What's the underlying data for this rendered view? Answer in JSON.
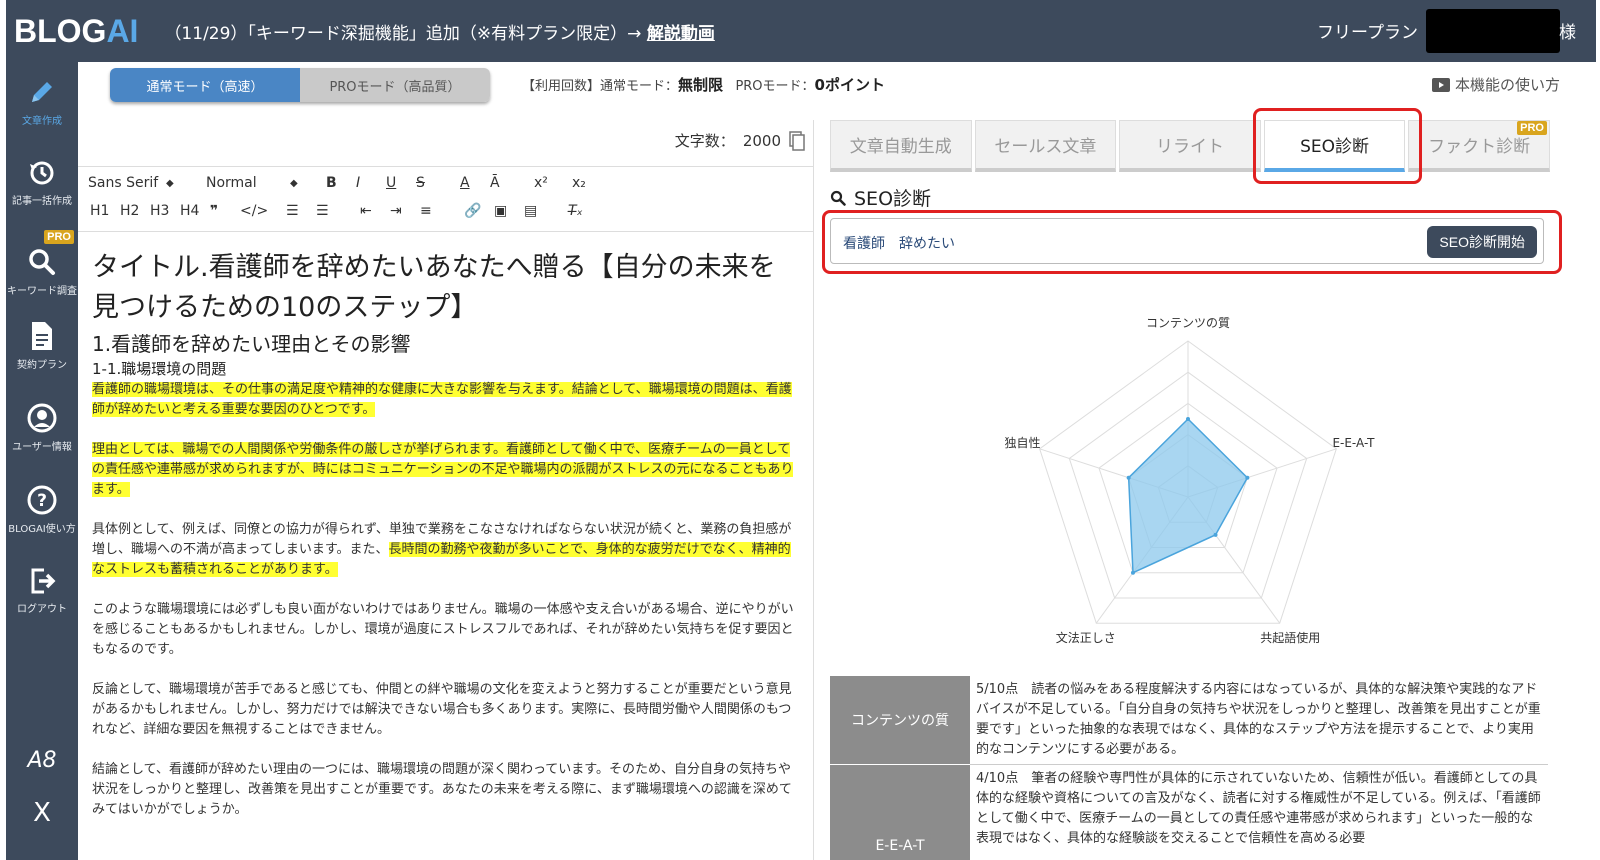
{
  "topbar": {
    "logo_part1": "BLOG",
    "logo_part2": "AI",
    "announcement": "（11/29）「キーワード深掘機能」追加（※有料プラン限定）→ ",
    "announcement_link": "解説動画",
    "plan": "フリープラン",
    "honorific": "様"
  },
  "sidebar": {
    "items": [
      {
        "label": "文章作成",
        "icon": "pencil-icon"
      },
      {
        "label": "記事一括作成",
        "icon": "history-icon"
      },
      {
        "label": "キーワード調査",
        "icon": "search-icon",
        "badge": "PRO"
      },
      {
        "label": "契約プラン",
        "icon": "document-icon"
      },
      {
        "label": "ユーザー情報",
        "icon": "user-icon"
      },
      {
        "label": "BLOGAI使い方",
        "icon": "question-icon"
      },
      {
        "label": "ログアウト",
        "icon": "logout-icon"
      }
    ],
    "footer": [
      "A8",
      "X"
    ]
  },
  "mode": {
    "normal": "通常モード（高速）",
    "pro": "PROモード（高品質）",
    "usage_prefix": "【利用回数】通常モード：",
    "usage_normal": "無制限",
    "usage_mid": "PROモード：",
    "usage_pro": "0ポイント",
    "howto": "本機能の使い方"
  },
  "editor": {
    "charcount_label": "文字数：",
    "charcount": "2000",
    "toolbar": {
      "font": "Sans Serif",
      "size": "Normal",
      "headings": [
        "H1",
        "H2",
        "H3",
        "H4"
      ]
    },
    "title": "タイトル.看護師を辞めたいあなたへ贈る【自分の未来を見つけるための10のステップ】",
    "h2": "1.看護師を辞めたい理由とその影響",
    "h3": "1-1.職場環境の問題",
    "p1": "看護師の職場環境は、その仕事の満足度や精神的な健康に大きな影響を与えます。結論として、職場環境の問題は、看護師が辞めたいと考える重要な要因のひとつです。",
    "p2": "理由としては、職場での人間関係や労働条件の厳しさが挙げられます。看護師として働く中で、医療チームの一員としての責任感や連帯感が求められますが、時にはコミュニケーションの不足や職場内の派閥がストレスの元になることもあります。",
    "p3a": "具体例として、例えば、同僚との協力が得られず、単独で業務をこなさなければならない状況が続くと、業務の負担感が増し、職場への不満が高まってしまいます。また、",
    "p3b": "長時間の勤務や夜勤が多いことで、身体的な疲労だけでなく、精神的なストレスも蓄積されることがあります。",
    "p4": "このような職場環境には必ずしも良い面がないわけではありません。職場の一体感や支え合いがある場合、逆にやりがいを感じることもあるかもしれません。しかし、環境が過度にストレスフルであれば、それが辞めたい気持ちを促す要因ともなるのです。",
    "p5": "反論として、職場環境が苦手であると感じても、仲間との絆や職場の文化を変えようと努力することが重要だという意見があるかもしれません。しかし、努力だけでは解決できない場合も多くあります。実際に、長時間労働や人間関係のもつれなど、詳細な要因を無視することはできません。",
    "p6": "結論として、看護師が辞めたい理由の一つには、職場環境の問題が深く関わっています。そのため、自分自身の気持ちや状況をしっかりと整理し、改善策を見出すことが重要です。あなたの未来を考える際に、まず職場環境への認識を深めてみてはいかがでしょうか。"
  },
  "tabs": [
    {
      "label": "文章自動生成",
      "active": false
    },
    {
      "label": "セールス文章",
      "active": false
    },
    {
      "label": "リライト",
      "active": false
    },
    {
      "label": "SEO診断",
      "active": true
    },
    {
      "label": "ファクト診断",
      "active": false,
      "badge": "PRO"
    }
  ],
  "seo": {
    "heading": "SEO診断",
    "keyword": "看護師　辞めたい",
    "button": "SEO診断開始"
  },
  "chart_data": {
    "type": "radar",
    "axes": [
      "コンテンツの質",
      "E-E-A-T",
      "共起語使用",
      "文法正しさ",
      "独自性"
    ],
    "values": [
      5,
      4,
      3,
      6,
      4
    ],
    "max": 10,
    "colors": {
      "fill": "#8cc8ec",
      "stroke": "#4aa4dc",
      "grid": "#dddddd"
    }
  },
  "scores": [
    {
      "name": "コンテンツの質",
      "text": "5/10点　読者の悩みをある程度解決する内容にはなっているが、具体的な解決策や実践的なアドバイスが不足している。「自分自身の気持ちや状況をしっかりと整理し、改善策を見出すことが重要です」といった抽象的な表現ではなく、具体的なステップや方法を提示することで、より実用的なコンテンツにする必要がある。"
    },
    {
      "name": "E-E-A-T",
      "text": "4/10点　筆者の経験や専門性が具体的に示されていないため、信頼性が低い。看護師としての具体的な経験や資格についての言及がなく、読者に対する権威性が不足している。例えば、「看護師として働く中で、医療チームの一員としての責任感や連帯感が求められます」といった一般的な表現ではなく、具体的な経験談を交えることで信頼性を高める必要"
    }
  ]
}
